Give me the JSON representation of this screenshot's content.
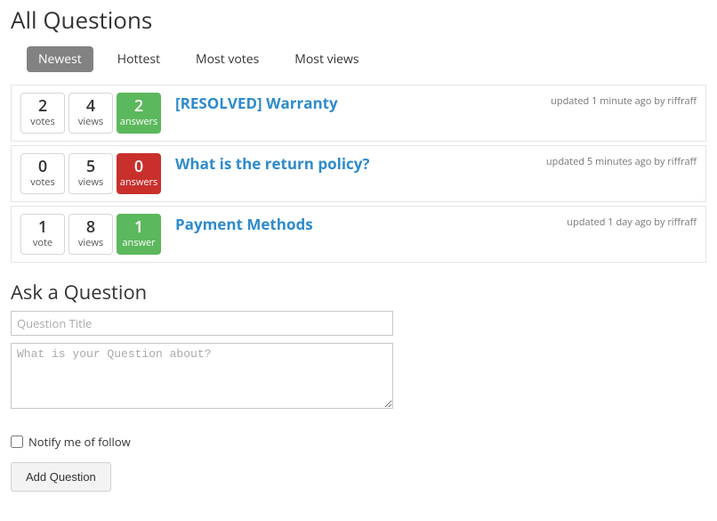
{
  "page_title": "All Questions",
  "tabs": [
    "Newest",
    "Hottest",
    "Most votes",
    "Most views"
  ],
  "active_tab": 0,
  "questions": [
    {
      "votes": 2,
      "votes_label": "votes",
      "views": 4,
      "views_label": "views",
      "answers": 2,
      "answers_label": "answers",
      "answers_style": "green",
      "title": "[RESOLVED] Warranty",
      "meta": "updated 1 minute ago by riffraff"
    },
    {
      "votes": 0,
      "votes_label": "votes",
      "views": 5,
      "views_label": "views",
      "answers": 0,
      "answers_label": "answers",
      "answers_style": "red",
      "title": "What is the return policy?",
      "meta": "updated 5 minutes ago by riffraff"
    },
    {
      "votes": 1,
      "votes_label": "vote",
      "views": 8,
      "views_label": "views",
      "answers": 1,
      "answers_label": "answer",
      "answers_style": "green",
      "title": "Payment Methods",
      "meta": "updated 1 day ago by riffraff"
    }
  ],
  "ask": {
    "heading": "Ask a Question",
    "title_placeholder": "Question Title",
    "body_placeholder": "What is your Question about?",
    "notify_label": "Notify me of follow",
    "submit_label": "Add Question"
  }
}
